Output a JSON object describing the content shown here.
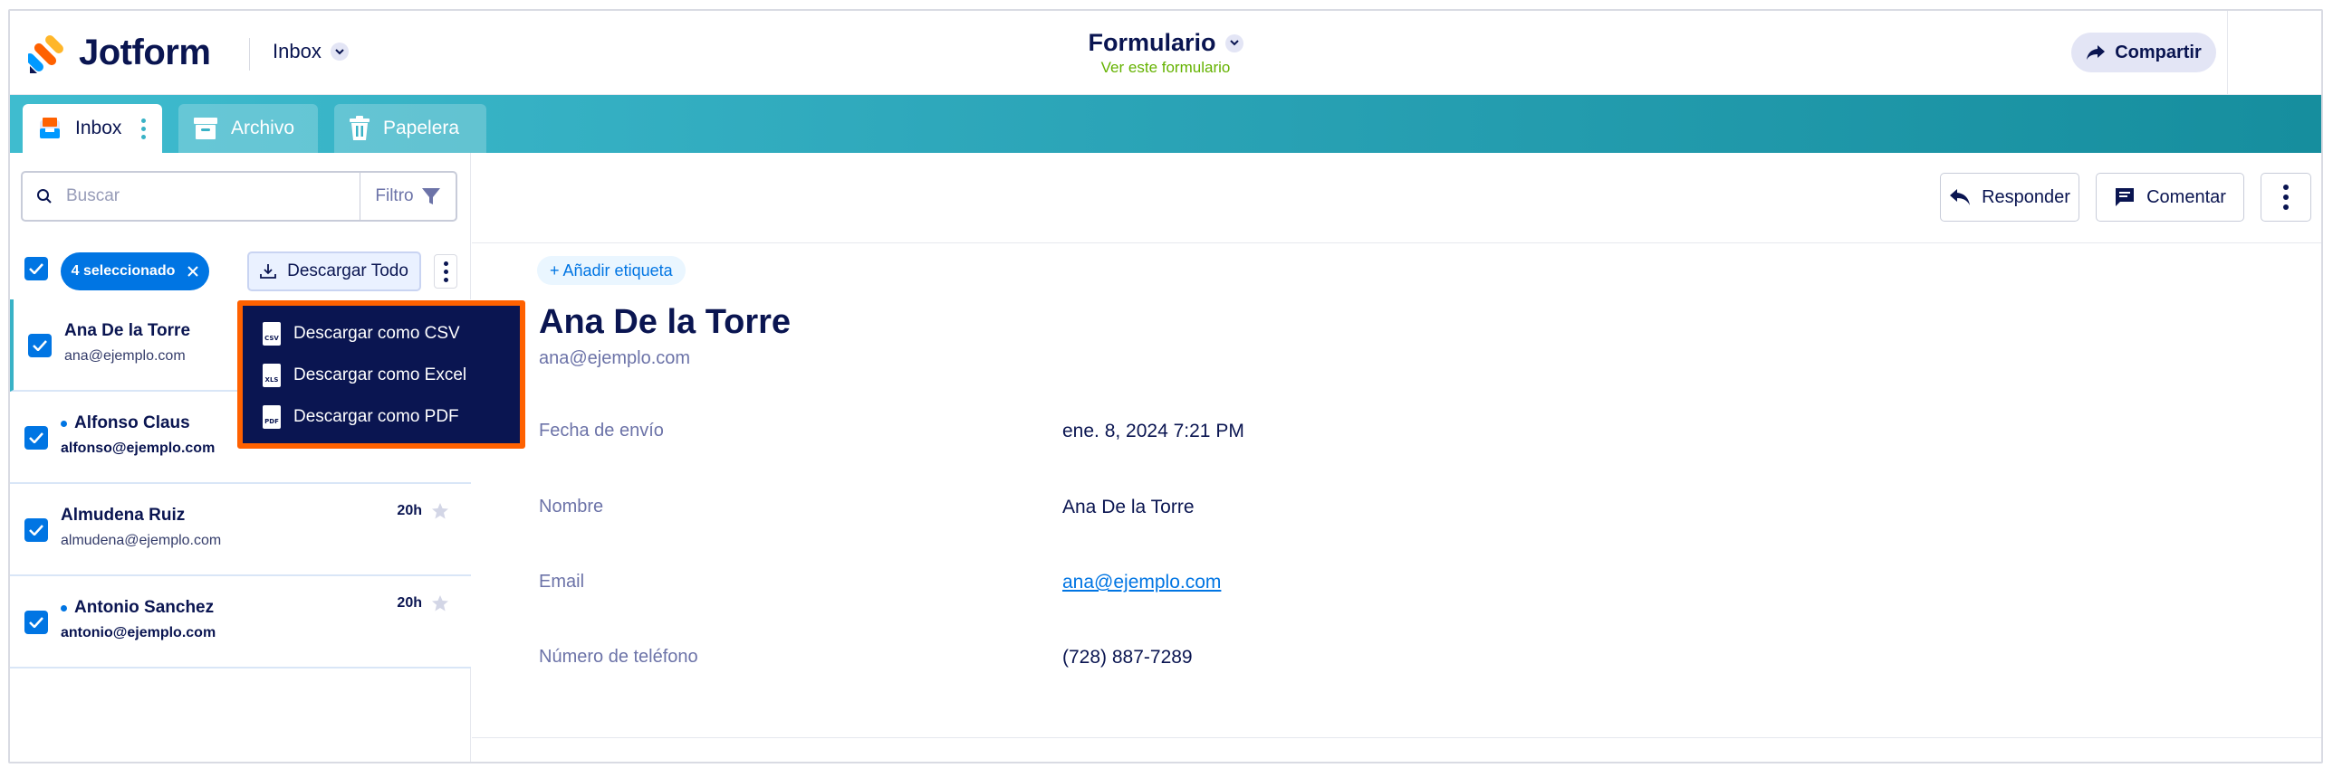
{
  "header": {
    "brand": "Jotform",
    "inbox_selector": "Inbox",
    "form_title": "Formulario",
    "form_link": "Ver este formulario",
    "share_label": "Compartir"
  },
  "tabs": [
    {
      "label": "Inbox"
    },
    {
      "label": "Archivo"
    },
    {
      "label": "Papelera"
    }
  ],
  "search": {
    "placeholder": "Buscar",
    "filter_label": "Filtro"
  },
  "list_toolbar": {
    "selected_label": "4 seleccionado",
    "download_all_label": "Descargar Todo"
  },
  "download_menu": [
    {
      "label": "Descargar como CSV",
      "badge": "CSV"
    },
    {
      "label": "Descargar como Excel",
      "badge": "XLS"
    },
    {
      "label": "Descargar como PDF",
      "badge": "PDF"
    }
  ],
  "submissions": [
    {
      "name": "Ana De la Torre",
      "email": "ana@ejemplo.com",
      "time": "",
      "unread": false,
      "active": true,
      "checked": true
    },
    {
      "name": "Alfonso Claus",
      "email": "alfonso@ejemplo.com",
      "time": "",
      "unread": true,
      "active": false,
      "checked": true
    },
    {
      "name": "Almudena Ruiz",
      "email": "almudena@ejemplo.com",
      "time": "20h",
      "unread": false,
      "active": false,
      "checked": true
    },
    {
      "name": "Antonio Sanchez",
      "email": "antonio@ejemplo.com",
      "time": "20h",
      "unread": true,
      "active": false,
      "checked": true
    }
  ],
  "detail": {
    "reply_label": "Responder",
    "comment_label": "Comentar",
    "add_tag_label": "+ Añadir etiqueta",
    "name": "Ana De la Torre",
    "email": "ana@ejemplo.com",
    "fields": [
      {
        "label": "Fecha de envío",
        "value": "ene. 8, 2024 7:21 PM",
        "is_link": false
      },
      {
        "label": "Nombre",
        "value": "Ana De la Torre",
        "is_link": false
      },
      {
        "label": "Email",
        "value": "ana@ejemplo.com",
        "is_link": true
      },
      {
        "label": "Número de teléfono",
        "value": "(728) 887-7289",
        "is_link": false
      }
    ]
  },
  "colors": {
    "brand_navy": "#0a1551",
    "accent_blue": "#0075e3",
    "teal": "#39b2c6",
    "highlight_orange": "#ff6100",
    "link_green": "#64b200"
  }
}
